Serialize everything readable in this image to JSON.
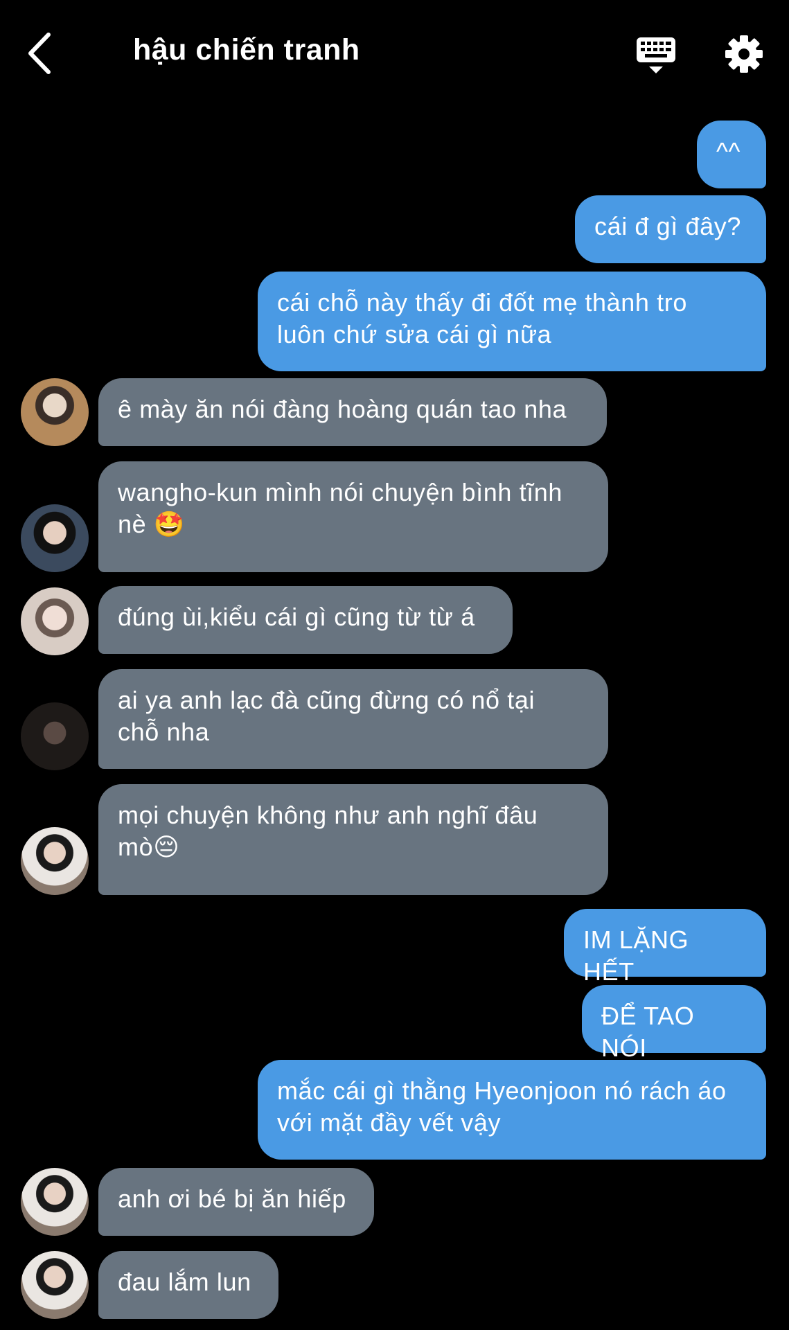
{
  "header": {
    "title": "hậu chiến tranh",
    "back_icon": "chevron-left-icon",
    "keyboard_icon": "keyboard-icon",
    "settings_icon": "gear-icon"
  },
  "colors": {
    "outgoing": "#4a9ae4",
    "incoming": "#687480",
    "background": "#000000"
  },
  "messages": [
    {
      "side": "out",
      "text": "^^"
    },
    {
      "side": "out",
      "text": "cái đ gì đây?"
    },
    {
      "side": "out",
      "text": "cái chỗ này thấy đi đốt mẹ thành tro\nluôn chứ sửa cái gì nữa"
    },
    {
      "side": "in",
      "text": "ê mày ăn nói đàng hoàng quán tao nha"
    },
    {
      "side": "in",
      "text": "wangho-kun mình nói chuyện bình tĩnh\nnè 🤩"
    },
    {
      "side": "in",
      "text": "đúng ùi,kiểu cái gì cũng từ từ á"
    },
    {
      "side": "in",
      "text": "ai ya anh lạc đà cũng đừng có nổ tại\nchỗ nha"
    },
    {
      "side": "in",
      "text": "mọi chuyện không như anh nghĩ đâu\nmò😔"
    },
    {
      "side": "out",
      "text": "IM LẶNG HẾT"
    },
    {
      "side": "out",
      "text": "ĐỂ TAO NÓI"
    },
    {
      "side": "out",
      "text": "mắc cái gì thằng Hyeonjoon nó rách áo\nvới mặt đầy vết vậy"
    },
    {
      "side": "in",
      "text": "anh ơi bé bị ăn hiếp"
    },
    {
      "side": "in",
      "text": "đau lắm lun"
    }
  ]
}
